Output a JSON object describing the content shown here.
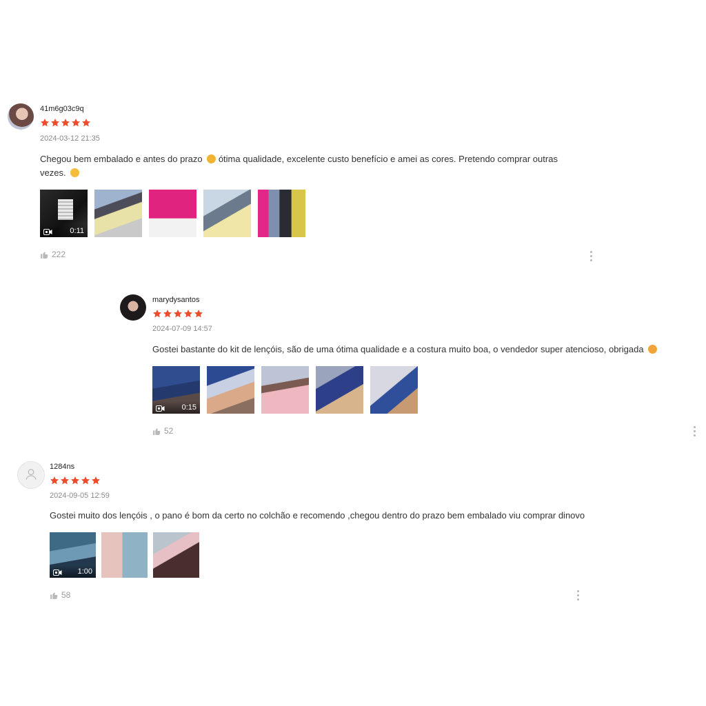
{
  "colors": {
    "star": "#ee4d2d",
    "text": "#333333",
    "muted": "#8a8a8a"
  },
  "reviews": [
    {
      "username": "41m6g03c9q",
      "rating": 5,
      "date": "2024-03-12 21:35",
      "text_part1": "Chegou bem embalado e antes do prazo ",
      "text_part2": " ótima qualidade, excelente custo benefício e amei as cores. Pretendo comprar outras",
      "text_part3": "vezes. ",
      "video_duration": "0:11",
      "likes": "222"
    },
    {
      "username": "marydysantos",
      "rating": 5,
      "date": "2024-07-09 14:57",
      "text": "Gostei bastante do kit de lençóis, são de uma ótima qualidade e a costura muito boa, o vendedor super atencioso, obrigada ",
      "video_duration": "0:15",
      "likes": "52"
    },
    {
      "username": "1284ns",
      "rating": 5,
      "date": "2024-09-05 12:59",
      "text": "Gostei muito dos lençóis , o pano é bom da certo no colchão e recomendo ,chegou dentro do prazo bem embalado viu comprar dinovo",
      "video_duration": "1:00",
      "likes": "58"
    }
  ]
}
